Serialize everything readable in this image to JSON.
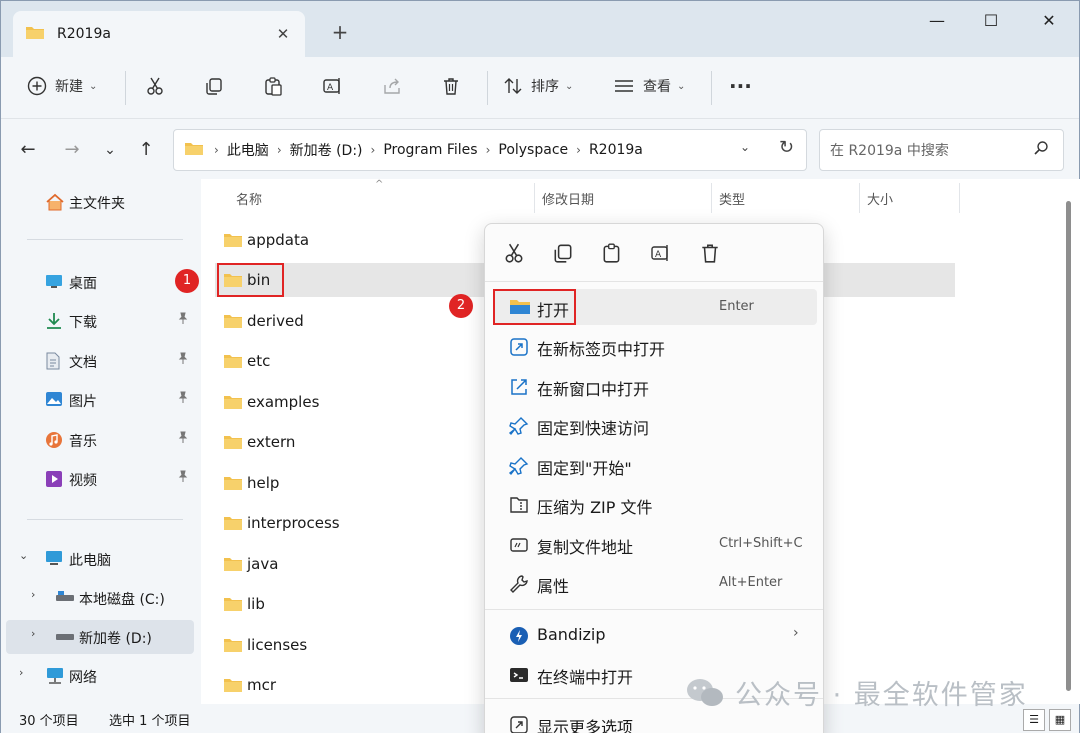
{
  "window": {
    "tab_title": "R2019a",
    "new_tab_symbol": "+",
    "tab_close_symbol": "✕",
    "minimize_symbol": "—",
    "maximize_symbol": "☐",
    "close_symbol": "✕"
  },
  "toolbar": {
    "new_label": "新建",
    "sort_label": "排序",
    "view_label": "查看",
    "more_symbol": "···"
  },
  "nav": {
    "back": "←",
    "forward": "→",
    "recent": "⌄",
    "up": "↑"
  },
  "address": {
    "crumbs": [
      "此电脑",
      "新加卷 (D:)",
      "Program Files",
      "Polyspace",
      "R2019a"
    ],
    "separator": "›",
    "dropdown": "⌄",
    "refresh": "↻"
  },
  "search": {
    "placeholder": "在 R2019a 中搜索"
  },
  "sidebar": {
    "home": "主文件夹",
    "quick": [
      {
        "label": "桌面",
        "icon": "desktop-icon"
      },
      {
        "label": "下载",
        "icon": "download-icon"
      },
      {
        "label": "文档",
        "icon": "document-icon"
      },
      {
        "label": "图片",
        "icon": "pictures-icon"
      },
      {
        "label": "音乐",
        "icon": "music-icon"
      },
      {
        "label": "视频",
        "icon": "video-icon"
      }
    ],
    "this_pc": "此电脑",
    "drive_c": "本地磁盘 (C:)",
    "drive_d": "新加卷 (D:)",
    "network": "网络",
    "pin_symbol": "📌"
  },
  "columns": {
    "name": "名称",
    "modified": "修改日期",
    "type": "类型",
    "size": "大小",
    "sort_symbol": "^"
  },
  "files": [
    "appdata",
    "bin",
    "derived",
    "etc",
    "examples",
    "extern",
    "help",
    "interprocess",
    "java",
    "lib",
    "licenses",
    "mcr"
  ],
  "annotations": {
    "step1": "1",
    "step2": "2"
  },
  "status": {
    "count": "30 个项目",
    "selected": "选中 1 个项目"
  },
  "context_menu": {
    "items": [
      {
        "label": "打开",
        "shortcut": "Enter",
        "icon": "folder-open-icon"
      },
      {
        "label": "在新标签页中打开",
        "shortcut": "",
        "icon": "new-tab-icon"
      },
      {
        "label": "在新窗口中打开",
        "shortcut": "",
        "icon": "new-window-icon"
      },
      {
        "label": "固定到快速访问",
        "shortcut": "",
        "icon": "pin-icon"
      },
      {
        "label": "固定到\"开始\"",
        "shortcut": "",
        "icon": "pin-start-icon"
      },
      {
        "label": "压缩为 ZIP 文件",
        "shortcut": "",
        "icon": "zip-icon"
      },
      {
        "label": "复制文件地址",
        "shortcut": "Ctrl+Shift+C",
        "icon": "copy-path-icon"
      },
      {
        "label": "属性",
        "shortcut": "Alt+Enter",
        "icon": "wrench-icon"
      },
      {
        "label": "Bandizip",
        "shortcut": "",
        "icon": "bandizip-icon"
      },
      {
        "label": "在终端中打开",
        "shortcut": "",
        "icon": "terminal-icon"
      },
      {
        "label": "显示更多选项",
        "shortcut": "",
        "icon": "more-options-icon"
      }
    ],
    "submenu_arrow": "›"
  },
  "watermark": {
    "text": "公众号 · 最全软件管家"
  },
  "colors": {
    "folder": "#f2c14e",
    "highlight_red": "#e02424",
    "accent_blue": "#1a73c8"
  }
}
